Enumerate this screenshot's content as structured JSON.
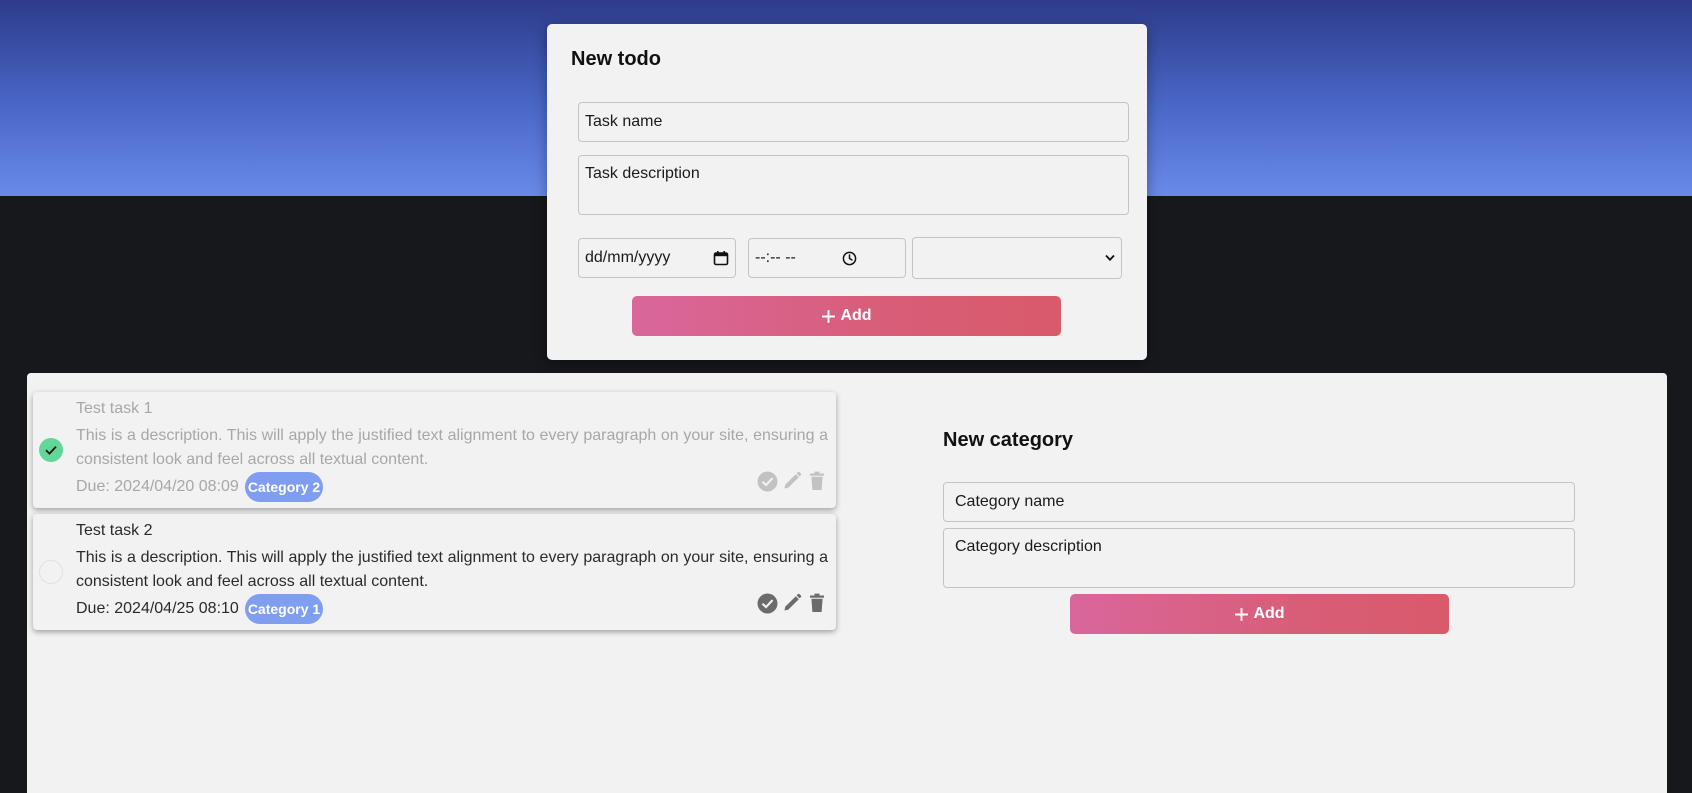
{
  "todo_form": {
    "title": "New todo",
    "task_name_placeholder": "Task name",
    "task_description_placeholder": "Task description",
    "date_placeholder": "dd/mm/yyyy",
    "time_placeholder": "--:-- --",
    "category_selected": "",
    "add_label": "Add"
  },
  "tasks": [
    {
      "title": "Test task 1",
      "description": "This is a description. This will apply the justified text alignment to every paragraph on your site, ensuring a consistent look and feel across all textual content.",
      "due": "Due: 2024/04/20 08:09",
      "category": "Category 2",
      "completed": true
    },
    {
      "title": "Test task 2",
      "description": "This is a description. This will apply the justified text alignment to every paragraph on your site, ensuring a consistent look and feel across all textual content.",
      "due": "Due: 2024/04/25 08:10",
      "category": "Category 1",
      "completed": false
    }
  ],
  "category_form": {
    "title": "New category",
    "name_placeholder": "Category name",
    "description_placeholder": "Category description",
    "add_label": "Add"
  },
  "colors": {
    "accent_gradient_start": "#d9679b",
    "accent_gradient_end": "#d95a6a",
    "badge": "#7f9ef0",
    "done_check": "#63d69a",
    "hero_top": "#2e3b8a",
    "hero_bottom": "#6a8ae8",
    "page_background": "#17181c"
  },
  "icons": {
    "calendar": "calendar-icon",
    "clock": "clock-icon",
    "select_arrow": "chevron-down-icon",
    "plus": "plus-icon",
    "check": "check-icon",
    "complete": "check-circle-icon",
    "edit": "pencil-icon",
    "delete": "trash-icon"
  }
}
